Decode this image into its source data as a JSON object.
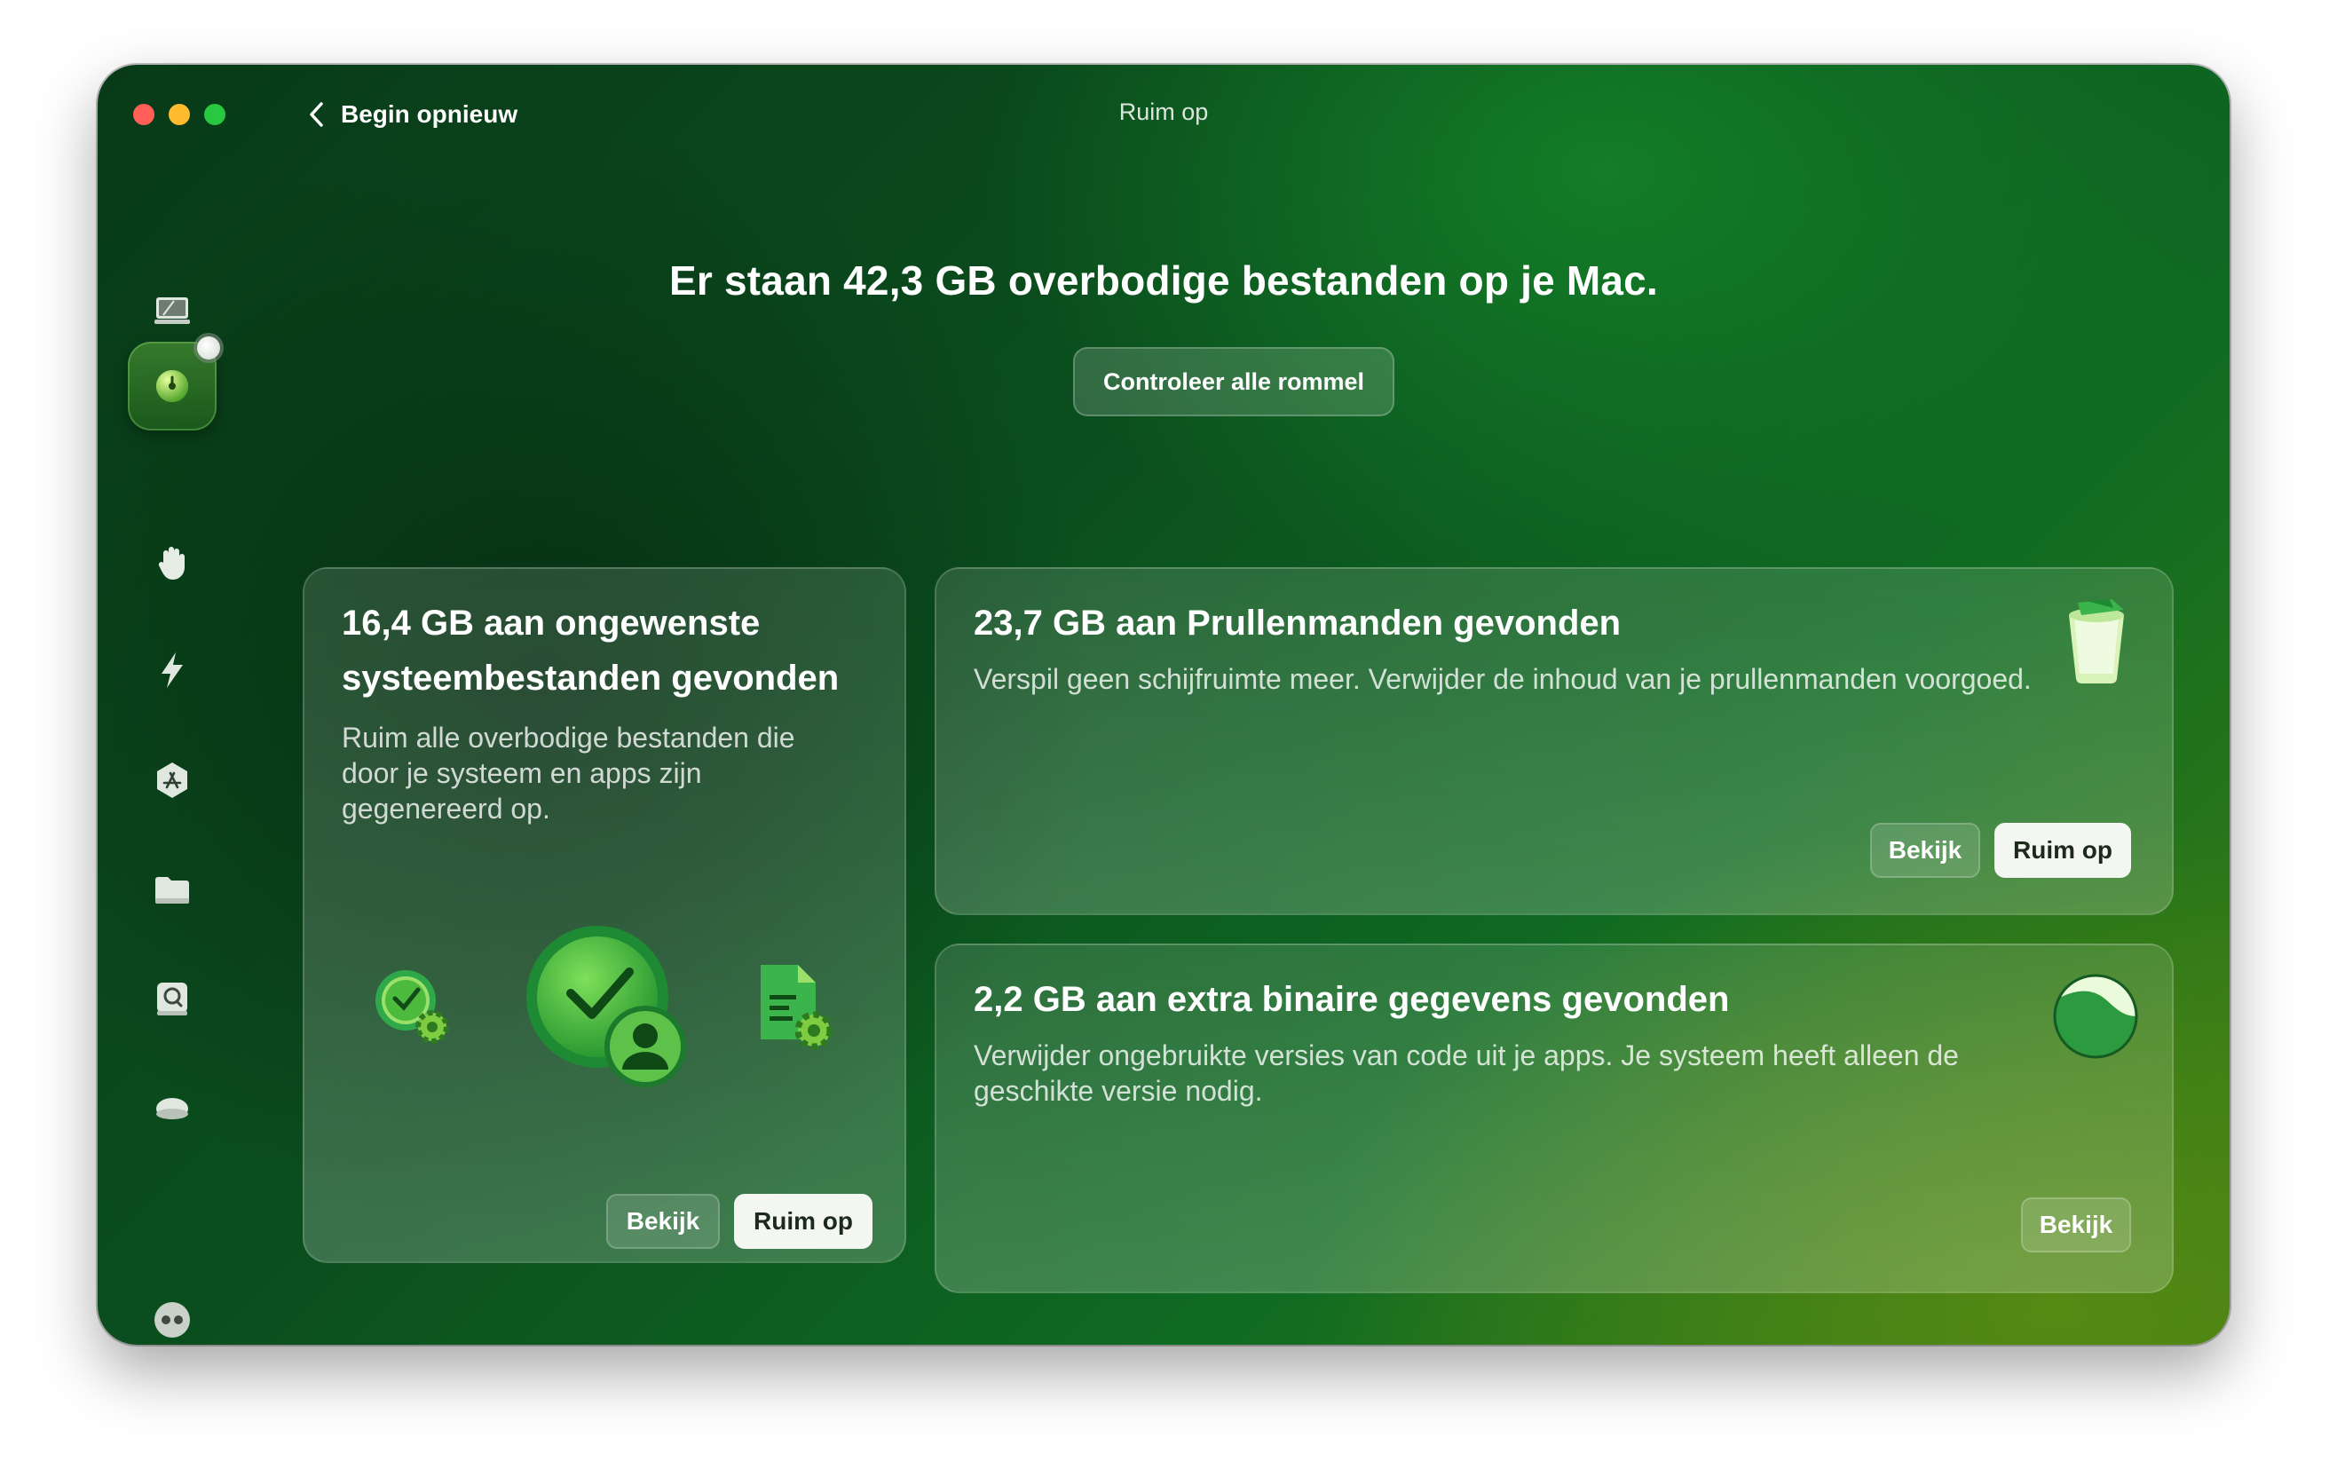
{
  "window": {
    "title": "Ruim op",
    "back_label": "Begin opnieuw"
  },
  "sidebar": {
    "items": [
      {
        "name": "smart-scan",
        "icon": "monitor-icon"
      },
      {
        "name": "cleanup",
        "icon": "cleanup-bubble-icon",
        "active": true
      },
      {
        "name": "protection",
        "icon": "hand-icon"
      },
      {
        "name": "performance",
        "icon": "bolt-icon"
      },
      {
        "name": "applications",
        "icon": "appstore-icon"
      },
      {
        "name": "my-clutter",
        "icon": "folder-icon"
      },
      {
        "name": "space-lens",
        "icon": "disk-search-icon"
      },
      {
        "name": "cloud",
        "icon": "cloud-icon"
      },
      {
        "name": "assistant",
        "icon": "assistant-dots-icon"
      }
    ]
  },
  "main": {
    "headline": "Er staan 42,3 GB overbodige bestanden op je Mac.",
    "check_all_label": "Controleer alle rommel"
  },
  "cards": {
    "system": {
      "title": "16,4 GB aan ongewenste systeembestanden gevonden",
      "description": "Ruim alle overbodige bestanden die door je systeem en apps zijn gegenereerd op.",
      "review_label": "Bekijk",
      "clean_label": "Ruim op"
    },
    "trash": {
      "title": "23,7 GB aan Prullenmanden gevonden",
      "description": "Verspil geen schijfruimte meer. Verwijder de inhoud van je prullenmanden voorgoed.",
      "review_label": "Bekijk",
      "clean_label": "Ruim op"
    },
    "binaries": {
      "title": "2,2 GB aan extra binaire gegevens gevonden",
      "description": "Verwijder ongebruikte versies van code uit je apps. Je systeem heeft alleen de geschikte versie nodig.",
      "review_label": "Bekijk"
    }
  },
  "colors": {
    "accent_green": "#2fa84a",
    "button_light": "#f4f6f2"
  }
}
